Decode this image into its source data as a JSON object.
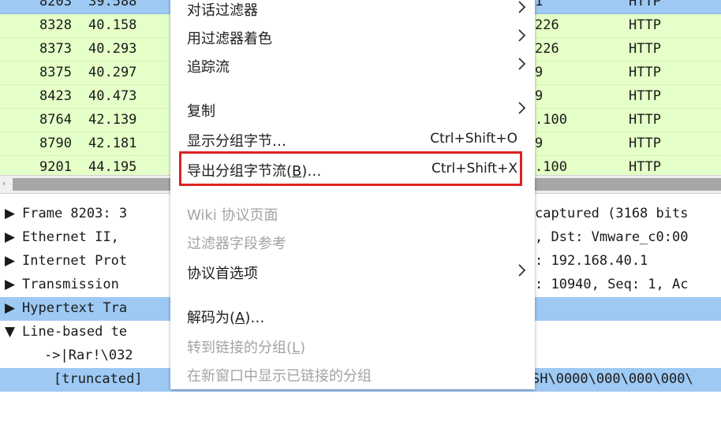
{
  "packet_list": {
    "rows": [
      {
        "no": "8203",
        "time": "39.588",
        "dst": "1",
        "proto": "HTTP",
        "selected": true
      },
      {
        "no": "8328",
        "time": "40.158",
        "dst": "226",
        "proto": "HTTP"
      },
      {
        "no": "8373",
        "time": "40.293",
        "dst": "226",
        "proto": "HTTP"
      },
      {
        "no": "8375",
        "time": "40.297",
        "dst": "9",
        "proto": "HTTP"
      },
      {
        "no": "8423",
        "time": "40.473",
        "dst": "9",
        "proto": "HTTP"
      },
      {
        "no": "8764",
        "time": "42.139",
        "dst": ".100",
        "proto": "HTTP"
      },
      {
        "no": "8790",
        "time": "42.181",
        "dst": "9",
        "proto": "HTTP"
      },
      {
        "no": "9201",
        "time": "44.195",
        "dst": ".100",
        "proto": "HTTP"
      }
    ]
  },
  "details": {
    "rows": [
      {
        "tri": "▶",
        "left": "Frame 8203: 3",
        "right": "captured (3168 bits"
      },
      {
        "tri": "▶",
        "left": "Ethernet II,",
        "right": ", Dst: Vmware_c0:00"
      },
      {
        "tri": "▶",
        "left": "Internet Prot",
        "right": ": 192.168.40.1"
      },
      {
        "tri": "▶",
        "left": "Transmission",
        "right": ": 10940, Seq: 1, Ac"
      },
      {
        "tri": "▶",
        "left": "Hypertext Tra",
        "right": "",
        "selected": true
      },
      {
        "tri": "▼",
        "left": "Line-based te",
        "right": ""
      },
      {
        "tri": "",
        "left": "->|Rar!\\032",
        "right": ""
      },
      {
        "tri": "",
        "left": "[truncated]",
        "right": "SH\\0000\\000\\000\\000\\",
        "selected": true
      }
    ]
  },
  "menu": {
    "items": [
      {
        "label": "对话过滤器",
        "submenu": true
      },
      {
        "label": "用过滤器着色",
        "submenu": true
      },
      {
        "label": "追踪流",
        "submenu": true
      },
      {
        "label": "复制",
        "submenu": true
      },
      {
        "label": "显示分组字节…",
        "shortcut": "Ctrl+Shift+O"
      },
      {
        "label_pre": "导出分组字节流(",
        "label_ul": "B",
        "label_post": ")…",
        "shortcut": "Ctrl+Shift+X",
        "highlighted": true
      },
      {
        "label": "Wiki 协议页面",
        "disabled": true
      },
      {
        "label": "过滤器字段参考",
        "disabled": true
      },
      {
        "label": "协议首选项",
        "submenu": true
      },
      {
        "label_pre": "解码为(",
        "label_ul": "A",
        "label_post": ")…"
      },
      {
        "label_pre": "转到链接的分组(",
        "label_ul": "L",
        "label_post": ")",
        "disabled": true
      },
      {
        "label": "在新窗口中显示已链接的分组",
        "disabled": true
      }
    ]
  }
}
